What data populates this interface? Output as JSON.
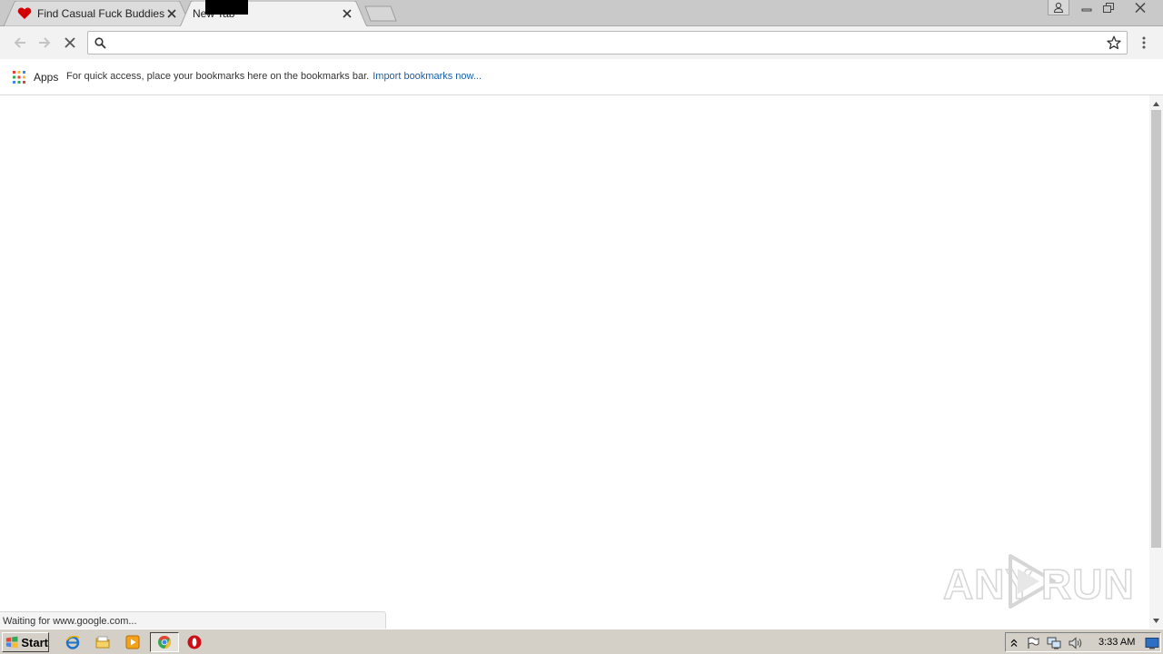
{
  "tabs": [
    {
      "title": "Find Casual Fuck Buddies",
      "active": false
    },
    {
      "title": "New Tab",
      "active": true
    }
  ],
  "toolbar": {
    "omnibox_value": "",
    "omnibox_placeholder": ""
  },
  "bookmarks": {
    "apps_label": "Apps",
    "message": "For quick access, place your bookmarks here on the bookmarks bar.",
    "import_link": "Import bookmarks now..."
  },
  "status": {
    "text": "Waiting for www.google.com..."
  },
  "watermark": {
    "left_text": "ANY",
    "right_text": "RUN"
  },
  "taskbar": {
    "start_label": "Start",
    "clock": "3:33 AM"
  },
  "colors": {
    "link": "#1a5fa8",
    "favicon_heart": "#d40000",
    "opera_red": "#cc0f16"
  },
  "icons": {
    "favicon": "heart-icon",
    "back": "back-arrow-icon",
    "forward": "forward-arrow-icon",
    "stop": "stop-icon",
    "search": "search-icon",
    "star": "star-icon",
    "menu": "menu-dots-icon",
    "apps": "apps-grid-icon"
  }
}
